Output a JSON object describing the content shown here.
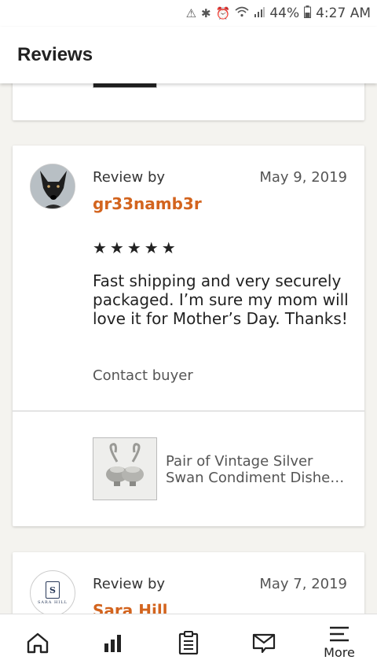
{
  "status_bar": {
    "battery": "44%",
    "time": "4:27 AM",
    "icons": [
      "android-auto-icon",
      "bluetooth-icon",
      "alarm-icon",
      "wifi-icon",
      "signal-icon",
      "battery-icon"
    ]
  },
  "header": {
    "title": "Reviews"
  },
  "reviews": [
    {
      "review_by_label": "Review by",
      "date": "May 9, 2019",
      "reviewer": "gr33namb3r",
      "stars": "★★★★★",
      "text": "Fast shipping and very securely packaged. I’m sure my mom will love it for Mother’s Day. Thanks!",
      "contact_label": "Contact buyer",
      "product_title": "Pair of Vintage Silver Swan Condiment Dishe…"
    },
    {
      "review_by_label": "Review by",
      "date": "May 7, 2019",
      "reviewer": "Sara Hill",
      "avatar_text": "SARA HILL"
    }
  ],
  "nav": {
    "items": [
      {
        "icon": "home-icon"
      },
      {
        "icon": "stats-icon"
      },
      {
        "icon": "orders-icon"
      },
      {
        "icon": "messages-icon"
      },
      {
        "icon": "menu-icon",
        "label": "More"
      }
    ]
  },
  "colors": {
    "accent": "#d3641e",
    "background": "#f4f3ef"
  }
}
